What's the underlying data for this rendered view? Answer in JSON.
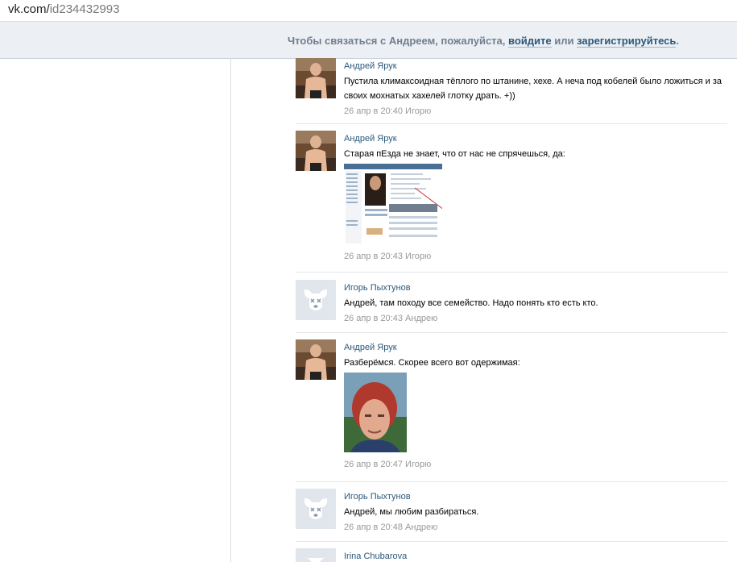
{
  "browser": {
    "url_domain": "vk.com/",
    "url_path": "id234432993"
  },
  "banner": {
    "prefix": "Чтобы связаться с Андреем, пожалуйста,",
    "login_link": "войдите",
    "or_text": "или",
    "register_link": "зарегистрируйтесь",
    "suffix": "."
  },
  "posts": [
    {
      "author": "Андрей Ярук",
      "text": "Пустила климаксоидная тёплого по штанине, хехе. А неча под кобелей было ложиться и за своих мохнатых хахелей глотку драть. +))",
      "date": "26 апр в 20:40",
      "reply_to": "Игорю"
    },
    {
      "author": "Андрей Ярук",
      "text": "Старая пЕзда не знает, что от нас не спрячешься, да:",
      "date": "26 апр в 20:43",
      "reply_to": "Игорю"
    },
    {
      "author": "Игорь Пыхтунов",
      "text": "Андрей, там походу все семейство. Надо понять кто есть кто.",
      "date": "26 апр в 20:43",
      "reply_to": "Андрею"
    },
    {
      "author": "Андрей Ярук",
      "text": "Разберёмся. Скорее всего вот одержимая:",
      "date": "26 апр в 20:47",
      "reply_to": "Игорю"
    },
    {
      "author": "Игорь Пыхтунов",
      "text": "Андрей, мы любим разбираться.",
      "date": "26 апр в 20:48",
      "reply_to": "Андрею"
    },
    {
      "author": "Irina Chubarova"
    }
  ],
  "colors": {
    "link": "#2b587a",
    "meta": "#999999",
    "banner_bg": "#eceff3",
    "banner_text": "#717f90"
  },
  "icons": {
    "deactivated_avatar": "vk-dog-icon"
  }
}
